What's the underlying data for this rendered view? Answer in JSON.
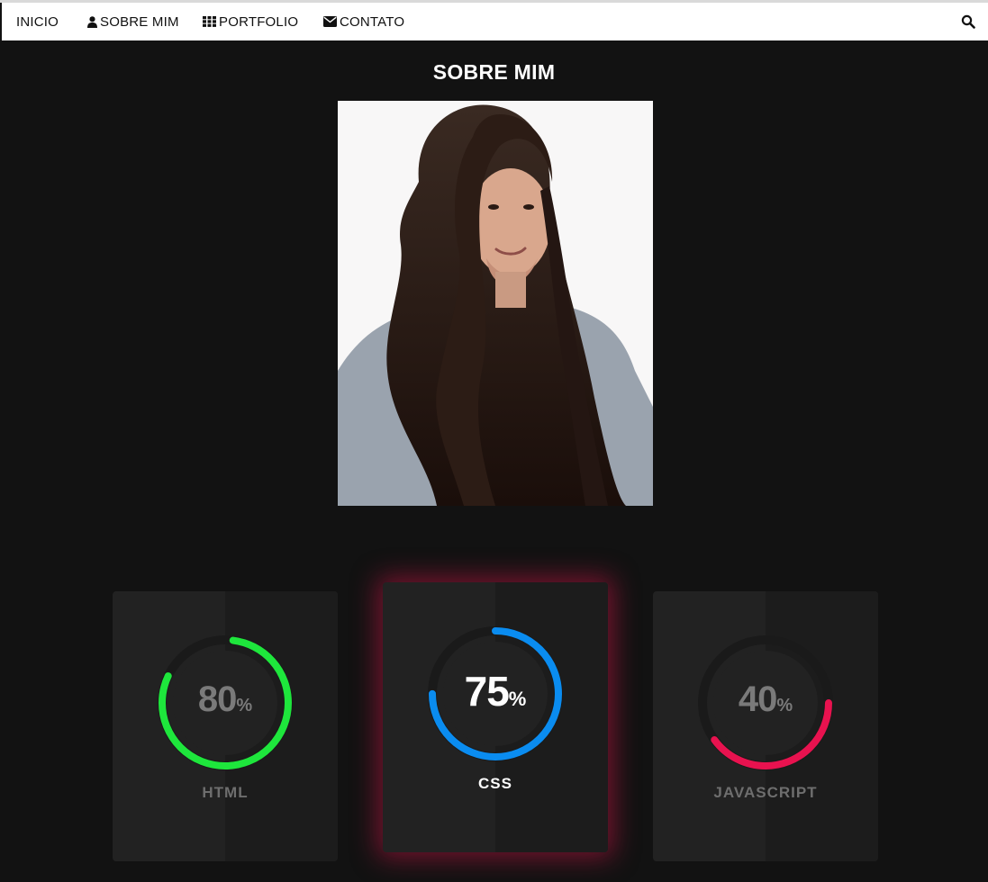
{
  "nav": {
    "items": [
      {
        "label": "INICIO",
        "icon": ""
      },
      {
        "label": "SOBRE MIM",
        "icon": "user-icon"
      },
      {
        "label": "PORTFOLIO",
        "icon": "grid-icon"
      },
      {
        "label": "CONTATO",
        "icon": "envelope-icon"
      }
    ],
    "search_icon": "search-icon"
  },
  "page": {
    "title": "SOBRE MIM"
  },
  "skills": [
    {
      "percent": "80",
      "symbol": "%",
      "label": "HTML",
      "value": 0.8,
      "color": "#1ee63c"
    },
    {
      "percent": "75",
      "symbol": "%",
      "label": "CSS",
      "value": 0.75,
      "color": "#0a8cf0"
    },
    {
      "percent": "40",
      "symbol": "%",
      "label": "JAVASCRIPT",
      "value": 0.4,
      "color": "#e8124f"
    }
  ],
  "colors": {
    "background": "#121212",
    "navbar": "#ffffff",
    "card": "#222222",
    "active_glow": "#c81446"
  }
}
